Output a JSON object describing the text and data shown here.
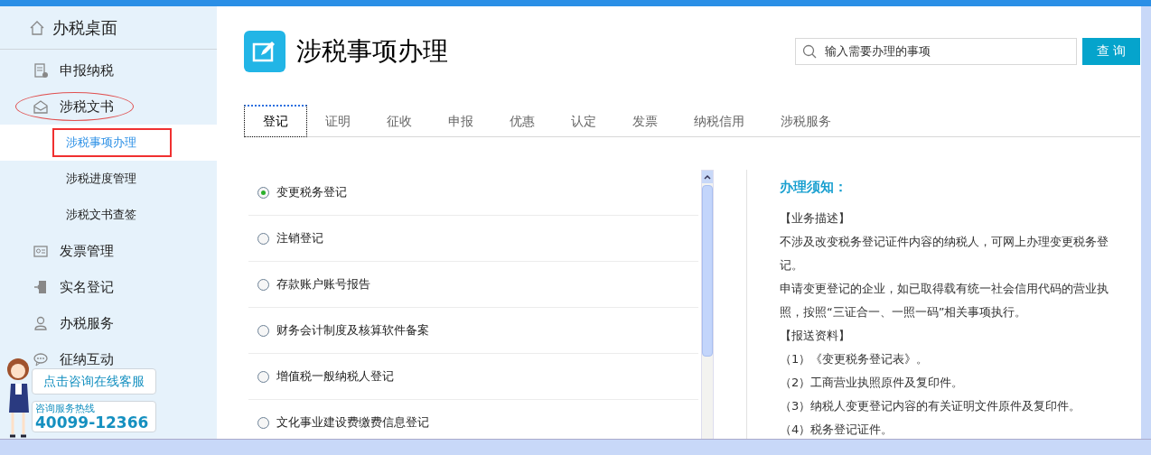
{
  "sidebar": {
    "home": "办税桌面",
    "items": [
      {
        "label": "申报纳税",
        "selected": false,
        "circled": false
      },
      {
        "label": "涉税文书",
        "selected": false,
        "circled": true,
        "children": [
          {
            "label": "涉税事项办理",
            "selected": true,
            "boxed": true
          },
          {
            "label": "涉税进度管理",
            "selected": false,
            "boxed": false
          },
          {
            "label": "涉税文书查签",
            "selected": false,
            "boxed": false
          }
        ]
      },
      {
        "label": "发票管理",
        "selected": false,
        "circled": false
      },
      {
        "label": "实名登记",
        "selected": false,
        "circled": false
      },
      {
        "label": "办税服务",
        "selected": false,
        "circled": false
      },
      {
        "label": "征纳互动",
        "selected": false,
        "circled": false
      }
    ]
  },
  "chat_widget": {
    "bubble": "点击咨询在线客服",
    "hotline_label": "咨询服务热线",
    "hotline_number": "40099-12366"
  },
  "page": {
    "title": "涉税事项办理",
    "search": {
      "placeholder": "输入需要办理的事项",
      "button": "查 询"
    }
  },
  "tabs": [
    {
      "label": "登记",
      "selected": true
    },
    {
      "label": "证明",
      "selected": false
    },
    {
      "label": "征收",
      "selected": false
    },
    {
      "label": "申报",
      "selected": false
    },
    {
      "label": "优惠",
      "selected": false
    },
    {
      "label": "认定",
      "selected": false
    },
    {
      "label": "发票",
      "selected": false
    },
    {
      "label": "纳税信用",
      "selected": false
    },
    {
      "label": "涉税服务",
      "selected": false
    }
  ],
  "options": [
    {
      "label": "变更税务登记",
      "selected": true
    },
    {
      "label": "注销登记",
      "selected": false
    },
    {
      "label": "存款账户账号报告",
      "selected": false
    },
    {
      "label": "财务会计制度及核算软件备案",
      "selected": false
    },
    {
      "label": "增值税一般纳税人登记",
      "selected": false
    },
    {
      "label": "文化事业建设费缴费信息登记",
      "selected": false
    }
  ],
  "notice": {
    "heading": "办理须知：",
    "paragraphs": [
      "【业务描述】",
      "不涉及改变税务登记证件内容的纳税人，可网上办理变更税务登记。",
      "申请变更登记的企业，如已取得载有统一社会信用代码的营业执照，按照“三证合一、一照一码”相关事项执行。",
      "【报送资料】",
      "（1）《变更税务登记表》。",
      "（2）工商营业执照原件及复印件。",
      "（3）纳税人变更登记内容的有关证明文件原件及复印件。",
      "（4）税务登记证件。"
    ]
  }
}
